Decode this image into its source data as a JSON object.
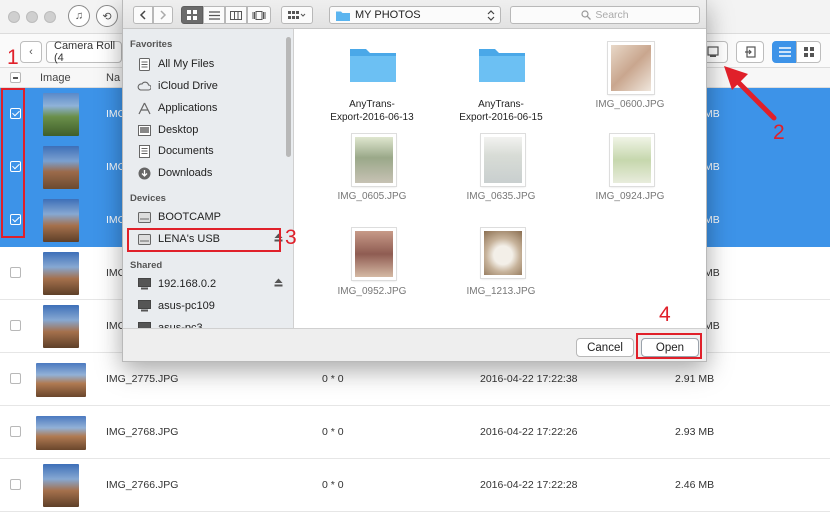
{
  "app": {
    "camera_roll_label": "Camera Roll (4",
    "columns": {
      "image": "Image",
      "name": "Na"
    },
    "rows": [
      {
        "name": "IMG",
        "dims": "",
        "date": "",
        "size": "MB",
        "selected": true
      },
      {
        "name": "IMG",
        "dims": "",
        "date": "",
        "size": "MB",
        "selected": true
      },
      {
        "name": "IMG",
        "dims": "",
        "date": "",
        "size": "MB",
        "selected": true
      },
      {
        "name": "IMG",
        "dims": "",
        "date": "",
        "size": "MB",
        "selected": false
      },
      {
        "name": "IMG",
        "dims": "",
        "date": "",
        "size": "MB",
        "selected": false
      },
      {
        "name": "IMG_2775.JPG",
        "dims": "0 * 0",
        "date": "2016-04-22 17:22:38",
        "size": "2.91 MB",
        "selected": false
      },
      {
        "name": "IMG_2768.JPG",
        "dims": "0 * 0",
        "date": "2016-04-22 17:22:26",
        "size": "2.93 MB",
        "selected": false
      },
      {
        "name": "IMG_2766.JPG",
        "dims": "0 * 0",
        "date": "2016-04-22 17:22:28",
        "size": "2.46 MB",
        "selected": false
      }
    ]
  },
  "dialog": {
    "location": "MY PHOTOS",
    "search_placeholder": "Search",
    "sidebar": {
      "favorites_header": "Favorites",
      "favorites": [
        "All My Files",
        "iCloud Drive",
        "Applications",
        "Desktop",
        "Documents",
        "Downloads"
      ],
      "devices_header": "Devices",
      "devices": [
        "BOOTCAMP",
        "LENA's USB"
      ],
      "shared_header": "Shared",
      "shared": [
        "192.168.0.2",
        "asus-pc109",
        "asus-pc3"
      ]
    },
    "files": [
      {
        "name": "AnyTrans-Export-2016-06-13",
        "line1": "AnyTrans-",
        "line2": "Export-2016-06-13",
        "kind": "folder"
      },
      {
        "name": "AnyTrans-Export-2016-06-15",
        "line1": "AnyTrans-",
        "line2": "Export-2016-06-15",
        "kind": "folder"
      },
      {
        "name": "IMG_0600.JPG",
        "kind": "image"
      },
      {
        "name": "IMG_0605.JPG",
        "kind": "image"
      },
      {
        "name": "IMG_0635.JPG",
        "kind": "image"
      },
      {
        "name": "IMG_0924.JPG",
        "kind": "image"
      },
      {
        "name": "IMG_0952.JPG",
        "kind": "image"
      },
      {
        "name": "IMG_1213.JPG",
        "kind": "image"
      }
    ],
    "cancel_label": "Cancel",
    "open_label": "Open"
  },
  "annotations": [
    "1",
    "2",
    "3",
    "4"
  ],
  "colors": {
    "selection": "#3d93e8",
    "annotation": "#e0202a",
    "folder": "#5ab4ef"
  }
}
